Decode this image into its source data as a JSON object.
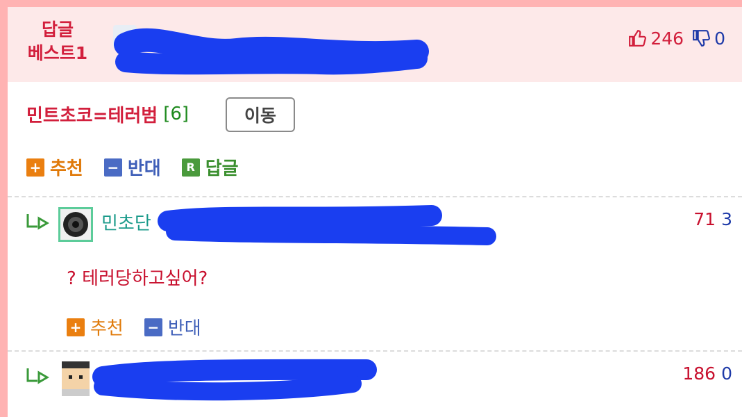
{
  "best_reply": {
    "label_line1": "답글",
    "label_line2": "베스트1",
    "upvotes": "246",
    "downvotes": "0"
  },
  "post": {
    "title": "민트초코=테러범",
    "reply_count": "[6]",
    "move_button": "이동"
  },
  "actions": {
    "recommend": "추천",
    "oppose": "반대",
    "reply": "답글",
    "reply_icon": "R"
  },
  "comments": [
    {
      "nickname": "민초단",
      "recommend": "71",
      "oppose": "3",
      "body": "? 테러당하고싶어?"
    },
    {
      "nickname": "",
      "recommend": "186",
      "oppose": "0"
    }
  ],
  "colors": {
    "frame": "#ffb3b3",
    "best_bg": "#fde9e9",
    "accent_red": "#d21f3c",
    "accent_blue": "#1e3aa8",
    "redaction": "#1a3ef0"
  },
  "icons": [
    "thumbs-up-icon",
    "thumbs-down-icon",
    "plus-icon",
    "minus-icon",
    "reply-r-icon",
    "reply-arrow-icon"
  ]
}
